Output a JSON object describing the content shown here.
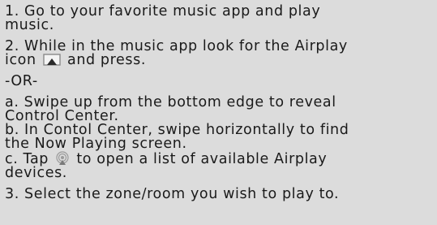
{
  "steps": {
    "s1": {
      "line1": "1. Go to your favorite music app and play",
      "line2": "music."
    },
    "s2": {
      "line1_a": "2. While in the music app look for the Airplay",
      "line2_a": "icon",
      "line2_b": "and press."
    },
    "or": "-OR-",
    "sa": {
      "line1": "a. Swipe up from the bottom edge to reveal",
      "line2": "Control Center."
    },
    "sb": {
      "line1": "b. In Contol Center, swipe horizontally to find",
      "line2": "the Now Playing screen."
    },
    "sc": {
      "line1_a": "c. Tap",
      "line1_b": "to open a list of available Airplay",
      "line2": "devices."
    },
    "s3": {
      "line1": "3. Select the zone/room you wish to play to."
    }
  },
  "icons": {
    "airplay": "airplay-icon",
    "airplay_audio": "airplay-audio-icon"
  },
  "colors": {
    "background": "#dcdcdc",
    "text": "#1a1a1a",
    "icon_fill": "#2a2a2a",
    "icon_frame": "#8a8a8a"
  }
}
